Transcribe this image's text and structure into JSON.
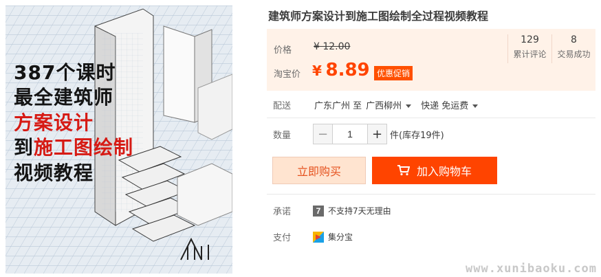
{
  "product": {
    "title": "建筑师方案设计到施工图绘制全过程视频教程",
    "image_text": {
      "line1": "387个课时",
      "line2": "最全建筑师",
      "line3": "方案设计",
      "line4_prefix": "到",
      "line4_highlight": "施工图绘制",
      "line5": "视频教程"
    }
  },
  "price": {
    "label": "价格",
    "original": "¥ 12.00",
    "taobao_label": "淘宝价",
    "currency": "¥",
    "taobao": "8.89",
    "promo_badge": "优惠促销"
  },
  "stats": [
    {
      "value": "129",
      "label": "累计评论"
    },
    {
      "value": "8",
      "label": "交易成功"
    }
  ],
  "delivery": {
    "label": "配送",
    "from": "广东广州 至",
    "to": "广西柳州",
    "shipping": "快递 免运费"
  },
  "quantity": {
    "label": "数量",
    "minus": "−",
    "value": "1",
    "plus": "+",
    "stock": "件(库存19件)"
  },
  "actions": {
    "buy_now": "立即购买",
    "add_to_cart": "加入购物车"
  },
  "promise": {
    "label": "承诺",
    "badge": "7",
    "text": "不支持7天无理由"
  },
  "payment": {
    "label": "支付",
    "method": "集分宝"
  },
  "watermark": "www.xunibaoku.com",
  "colors": {
    "accent": "#ff4400",
    "price_panel_bg": "#fff2e8",
    "buy_now_bg": "#ffe4d0"
  }
}
